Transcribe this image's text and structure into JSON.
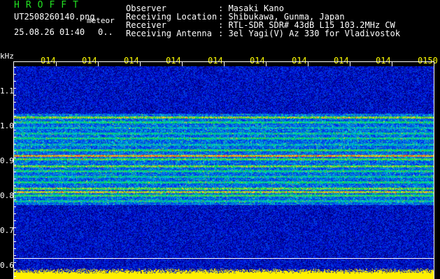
{
  "header": {
    "brand": "HROFFT",
    "filename": "UT2508260140.png",
    "subtitle": "meteor",
    "datetime": "25.08.26 01:40",
    "dot_glyph": "0..",
    "info": [
      {
        "label": "Observer",
        "value": ": Masaki Kano"
      },
      {
        "label": "Receiving Location",
        "value": ": Shibukawa, Gunma, Japan"
      },
      {
        "label": "Receiver",
        "value": ": RTL-SDR SDR# 43dB L15 103.2MHz CW"
      },
      {
        "label": "Receiving Antenna",
        "value": ": 3el Yagi(V) Az 330 for Vladivostok"
      }
    ]
  },
  "axis": {
    "unit": "kHz",
    "y_ticks": [
      "1.1",
      "1.0",
      "0.9",
      "0.8",
      "0.7",
      "0.6"
    ],
    "x_ticks": [
      "014",
      "014",
      "014",
      "014",
      "014",
      "014",
      "014",
      "014",
      "014",
      "0150"
    ]
  },
  "colors": {
    "background": "#000000",
    "brand": "#22e022",
    "tick_label": "#ffff00",
    "spectrum_low": "#00008b",
    "spectrum_high": "#ff2020",
    "level_bar": "#ffff00"
  }
}
